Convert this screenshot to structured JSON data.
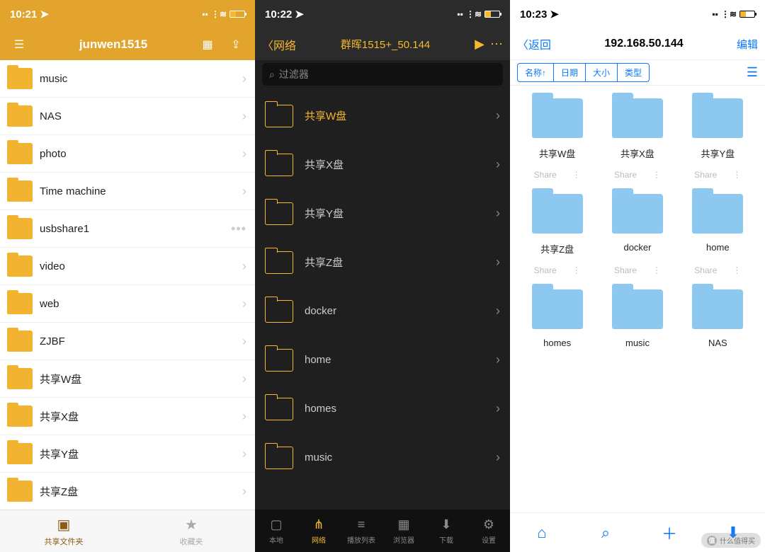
{
  "paneA": {
    "status_time": "10:21",
    "title": "junwen1515",
    "rows": [
      {
        "label": "music",
        "tail": "chev"
      },
      {
        "label": "NAS",
        "tail": "chev"
      },
      {
        "label": "photo",
        "tail": "chev"
      },
      {
        "label": "Time machine",
        "tail": "chev"
      },
      {
        "label": "usbshare1",
        "tail": "dots"
      },
      {
        "label": "video",
        "tail": "chev"
      },
      {
        "label": "web",
        "tail": "chev"
      },
      {
        "label": "ZJBF",
        "tail": "chev"
      },
      {
        "label": "共享W盘",
        "tail": "chev"
      },
      {
        "label": "共享X盘",
        "tail": "chev"
      },
      {
        "label": "共享Y盘",
        "tail": "chev"
      },
      {
        "label": "共享Z盘",
        "tail": "chev"
      }
    ],
    "tabs": [
      {
        "label": "共享文件夹",
        "active": true
      },
      {
        "label": "收藏夹",
        "active": false
      }
    ]
  },
  "paneB": {
    "status_time": "10:22",
    "back_label": "网络",
    "title": "群晖1515+_50.144",
    "filter_placeholder": "过滤器",
    "rows": [
      {
        "label": "共享W盘",
        "sel": true
      },
      {
        "label": "共享X盘"
      },
      {
        "label": "共享Y盘"
      },
      {
        "label": "共享Z盘"
      },
      {
        "label": "docker"
      },
      {
        "label": "home"
      },
      {
        "label": "homes"
      },
      {
        "label": "music"
      }
    ],
    "tabs": [
      "本地",
      "网络",
      "播放列表",
      "浏览器",
      "下载",
      "设置"
    ],
    "active_tab": 1
  },
  "paneC": {
    "status_time": "10:23",
    "back_label": "返回",
    "title": "192.168.50.144",
    "edit_label": "编辑",
    "sort": [
      "名称↑",
      "日期",
      "大小",
      "类型"
    ],
    "share_label": "Share",
    "grid": [
      [
        "共享W盘",
        "共享X盘",
        "共享Y盘"
      ],
      [
        "共享Z盘",
        "docker",
        "home"
      ],
      [
        "homes",
        "music",
        "NAS"
      ]
    ],
    "watermark": "什么值得买"
  }
}
